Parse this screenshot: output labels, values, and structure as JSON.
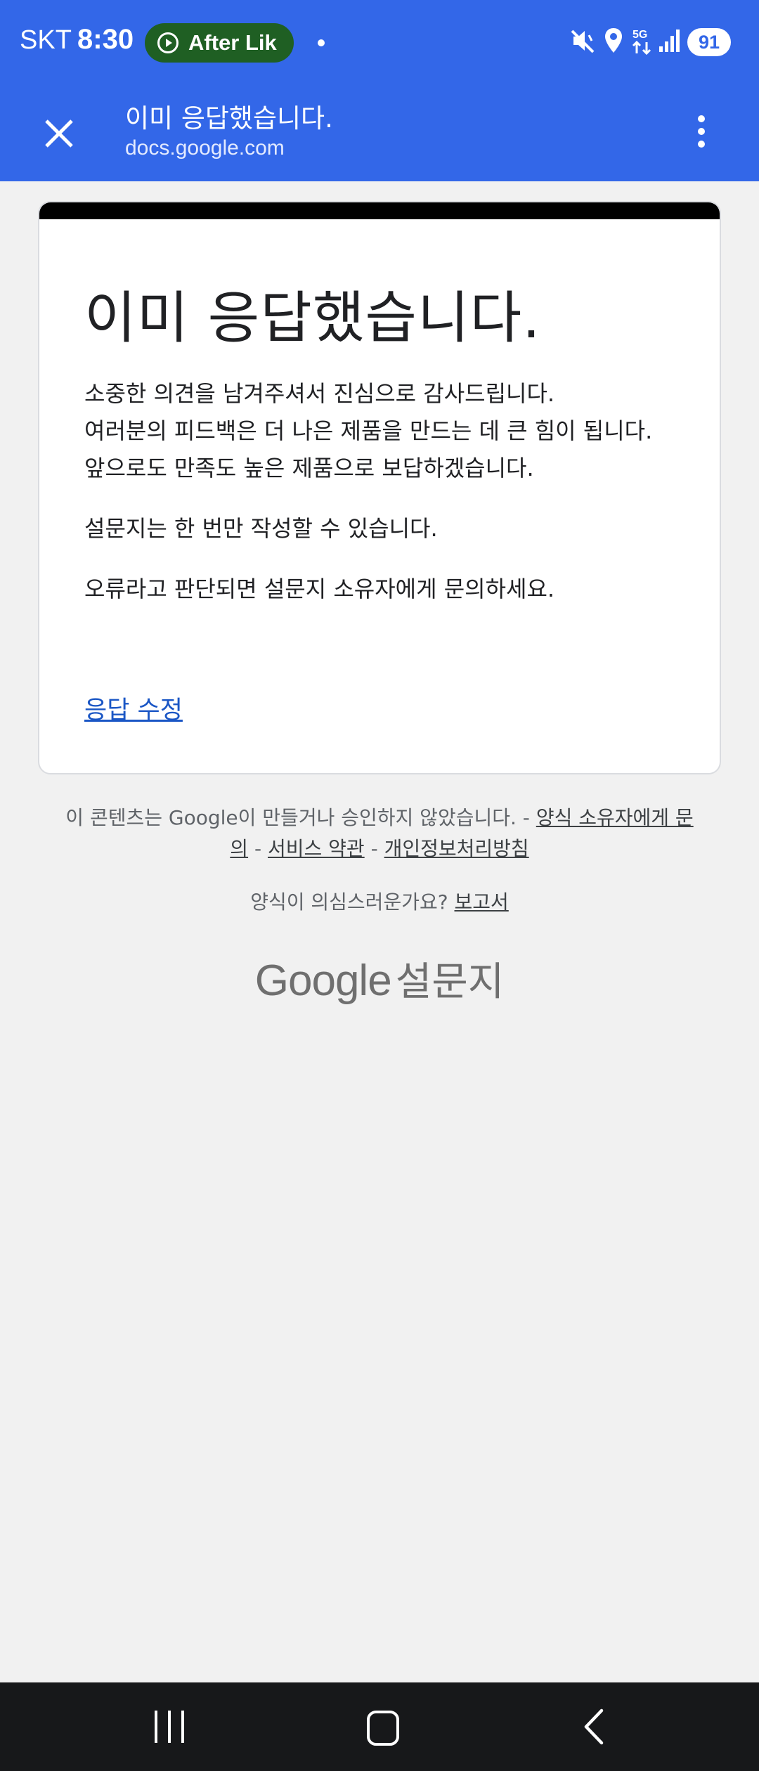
{
  "status_bar": {
    "carrier": "SKT",
    "time": "8:30",
    "media_pill": "After Lik",
    "network_label": "5G",
    "battery": "91"
  },
  "browser": {
    "title": "이미 응답했습니다.",
    "url": "docs.google.com"
  },
  "card": {
    "heading": "이미 응답했습니다.",
    "message_lines": [
      "소중한 의견을 남겨주셔서 진심으로 감사드립니다.",
      "여러분의 피드백은 더 나은 제품을 만드는 데 큰 힘이 됩니다.",
      "앞으로도 만족도 높은 제품으로 보답하겠습니다."
    ],
    "once_notice": "설문지는 한 번만 작성할 수 있습니다.",
    "contact_notice": "오류라고 판단되면 설문지 소유자에게 문의하세요.",
    "edit_link": "응답 수정"
  },
  "footer": {
    "disclaimer": "이 콘텐츠는 Google이 만들거나 승인하지 않았습니다.",
    "sep": "-",
    "contact_owner": "양식 소유자에게 문의",
    "terms": "서비스 약관",
    "privacy": "개인정보처리방침",
    "report_question": "양식이 의심스러운가요?",
    "report_link": "보고서",
    "brand_google": "Google",
    "brand_product": "설문지"
  },
  "colors": {
    "app_bar": "#3367e8",
    "link": "#1a56c5",
    "page_bg": "#f1f1f1",
    "nav_bar": "#17181a"
  }
}
